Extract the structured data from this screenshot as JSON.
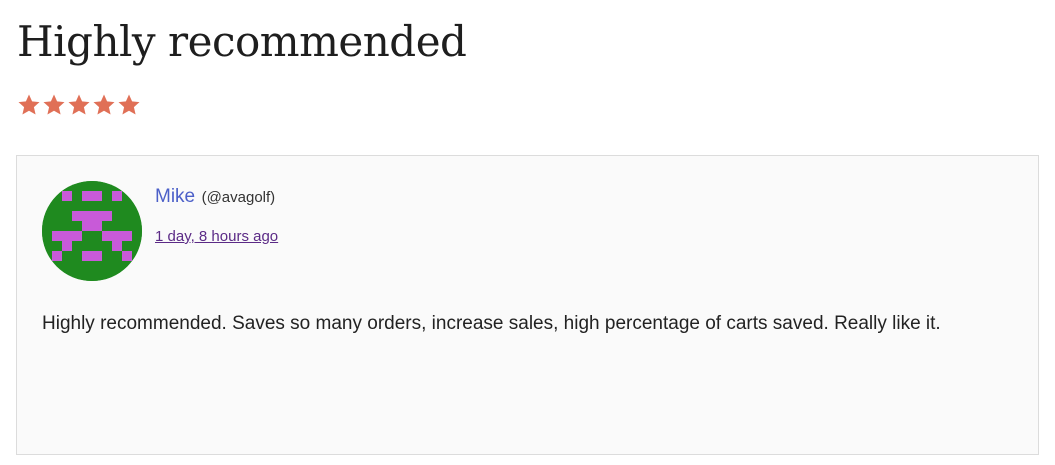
{
  "review": {
    "title": "Highly recommended",
    "rating": 5,
    "rating_max": 5,
    "star_color": "#e07057",
    "author": {
      "name": "Mike",
      "handle": "(@avagolf)",
      "avatar_icon": "identicon-avatar",
      "avatar_bg_color": "#1f8a1f",
      "avatar_fg_color": "#c85ad8"
    },
    "date": "1 day, 8 hours ago",
    "body": "Highly recommended. Saves so many orders, increase sales, high percentage of carts saved. Really like it."
  }
}
